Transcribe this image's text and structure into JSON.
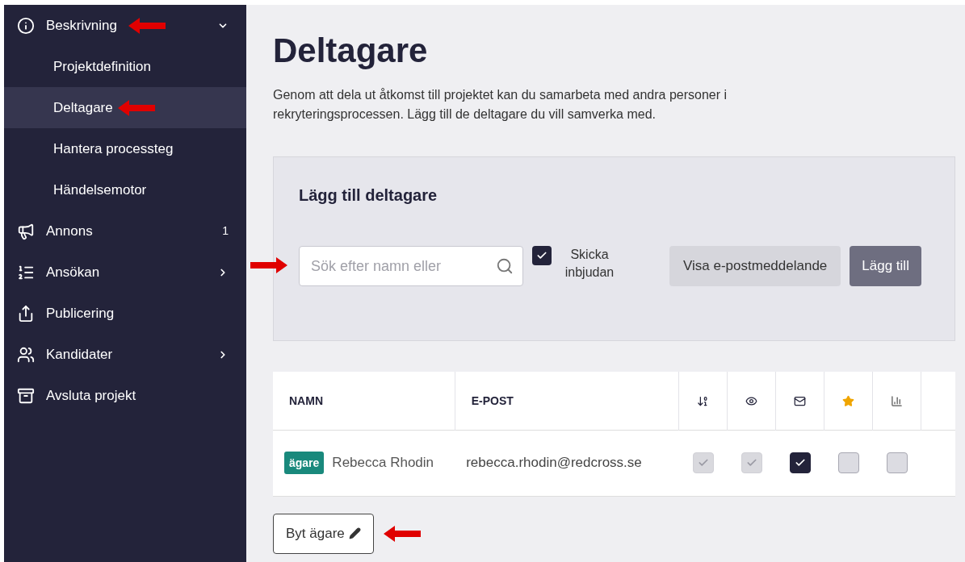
{
  "sidebar": {
    "items": [
      {
        "label": "Beskrivning",
        "expanded": true,
        "annotated": true,
        "children": [
          {
            "label": "Projektdefinition",
            "selected": false,
            "annotated": false
          },
          {
            "label": "Deltagare",
            "selected": true,
            "annotated": true
          },
          {
            "label": "Hantera processteg",
            "selected": false,
            "annotated": false
          },
          {
            "label": "Händelsemotor",
            "selected": false,
            "annotated": false
          }
        ]
      },
      {
        "label": "Annons",
        "badge": "1",
        "annotated": false
      },
      {
        "label": "Ansökan",
        "expanded": false,
        "annotated": false
      },
      {
        "label": "Publicering",
        "annotated": false
      },
      {
        "label": "Kandidater",
        "expanded": false,
        "annotated": false
      },
      {
        "label": "Avsluta projekt",
        "annotated": false
      }
    ]
  },
  "page": {
    "title": "Deltagare",
    "description": "Genom att dela ut åtkomst till projektet kan du samarbeta med andra personer i rekryteringsprocessen. Lägg till de deltagare du vill samverka med."
  },
  "add_panel": {
    "title": "Lägg till deltagare",
    "search": {
      "placeholder": "Sök efter namn eller"
    },
    "send_invite": {
      "label": "Skicka inbjudan",
      "checked": true
    },
    "buttons": [
      "Visa e-postmeddelande",
      "Lägg till"
    ]
  },
  "table": {
    "columns": [
      {
        "kind": "text",
        "label": "NAMN"
      },
      {
        "kind": "text",
        "label": "E-POST"
      },
      {
        "kind": "icon"
      },
      {
        "kind": "icon"
      },
      {
        "kind": "icon"
      },
      {
        "kind": "icon"
      },
      {
        "kind": "icon"
      },
      {
        "kind": "blank"
      }
    ],
    "rows": [
      {
        "tag": "ägare",
        "name": "Rebecca Rhodin",
        "email": "rebecca.rhodin@redcross.se",
        "permissions": [
          {
            "checked": true,
            "disabled": true
          },
          {
            "checked": true,
            "disabled": true
          },
          {
            "checked": true,
            "disabled": false
          },
          {
            "checked": false,
            "disabled": false
          },
          {
            "checked": false,
            "disabled": false
          }
        ]
      }
    ]
  },
  "change_owner": {
    "label": "Byt ägare",
    "annotated": true
  }
}
